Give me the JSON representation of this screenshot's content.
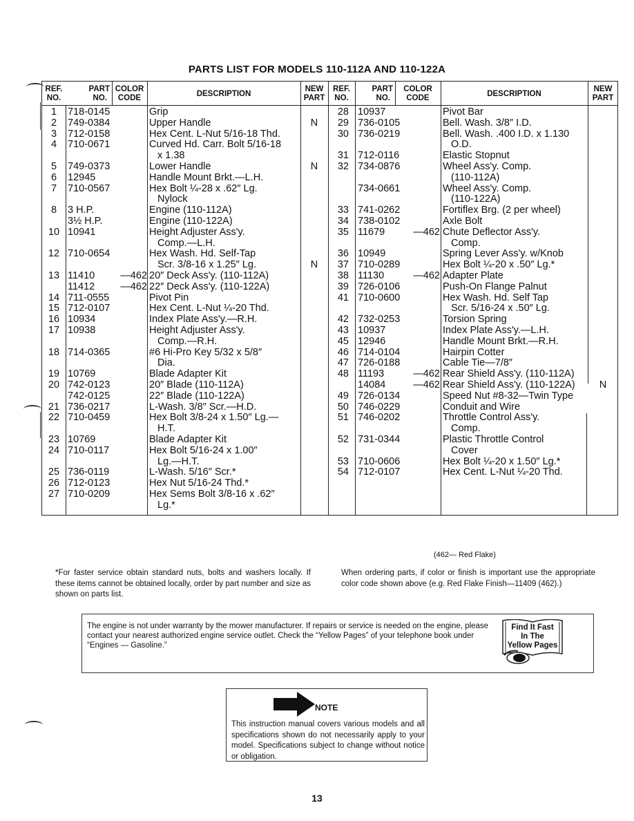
{
  "title": "PARTS LIST FOR MODELS 110-112A AND 110-122A",
  "headers": {
    "ref_no": [
      "REF.",
      "NO."
    ],
    "part_no": [
      "PART",
      "NO."
    ],
    "color_code": [
      "COLOR",
      "CODE"
    ],
    "description": "DESCRIPTION",
    "new_part": [
      "NEW",
      "PART"
    ]
  },
  "left_rows": [
    {
      "ref": "1",
      "part": "718-0145",
      "code": "",
      "desc": [
        "Grip"
      ],
      "new": ""
    },
    {
      "ref": "2",
      "part": "749-0384",
      "code": "",
      "desc": [
        "Upper Handle"
      ],
      "new": "N"
    },
    {
      "ref": "3",
      "part": "712-0158",
      "code": "",
      "desc": [
        "Hex Cent. L-Nut 5/16-18 Thd."
      ],
      "new": ""
    },
    {
      "ref": "4",
      "part": "710-0671",
      "code": "",
      "desc": [
        "Curved Hd. Carr. Bolt 5/16-18",
        "x 1.38"
      ],
      "new": ""
    },
    {
      "ref": "5",
      "part": "749-0373",
      "code": "",
      "desc": [
        "Lower Handle"
      ],
      "new": "N"
    },
    {
      "ref": "6",
      "part": "12945",
      "code": "",
      "desc": [
        "Handle Mount Brkt.—L.H."
      ],
      "new": ""
    },
    {
      "ref": "7",
      "part": "710-0567",
      "code": "",
      "desc": [
        "Hex Bolt ¼-28 x .62″ Lg.",
        "Nylock"
      ],
      "new": ""
    },
    {
      "ref": "8",
      "part": "3 H.P.",
      "code": "",
      "desc": [
        "Engine (110-112A)"
      ],
      "new": ""
    },
    {
      "ref": "",
      "part": "3½ H.P.",
      "code": "",
      "desc": [
        "Engine (110-122A)"
      ],
      "new": ""
    },
    {
      "ref": "10",
      "part": "10941",
      "code": "",
      "desc": [
        "Height Adjuster Ass'y.",
        "Comp.—L.H."
      ],
      "new": ""
    },
    {
      "ref": "12",
      "part": "710-0654",
      "code": "",
      "desc": [
        "Hex Wash. Hd. Self-Tap",
        "Scr. 3/8-16 x 1.25″ Lg."
      ],
      "new": "N"
    },
    {
      "ref": "13",
      "part": "11410",
      "code": "—462",
      "desc": [
        "20″ Deck Ass'y. (110-112A)"
      ],
      "new": ""
    },
    {
      "ref": "",
      "part": "11412",
      "code": "—462",
      "desc": [
        "22″ Deck Ass'y. (110-122A)"
      ],
      "new": ""
    },
    {
      "ref": "14",
      "part": "711-0555",
      "code": "",
      "desc": [
        "Pivot Pin"
      ],
      "new": ""
    },
    {
      "ref": "15",
      "part": "712-0107",
      "code": "",
      "desc": [
        "Hex Cent. L-Nut ¼-20 Thd."
      ],
      "new": ""
    },
    {
      "ref": "16",
      "part": "10934",
      "code": "",
      "desc": [
        "Index Plate Ass'y.—R.H."
      ],
      "new": ""
    },
    {
      "ref": "17",
      "part": "10938",
      "code": "",
      "desc": [
        "Height Adjuster Ass'y.",
        "Comp.—R.H."
      ],
      "new": ""
    },
    {
      "ref": "18",
      "part": "714-0365",
      "code": "",
      "desc": [
        "#6 Hi-Pro Key 5/32 x 5/8″",
        "Dia."
      ],
      "new": ""
    },
    {
      "ref": "19",
      "part": "10769",
      "code": "",
      "desc": [
        "Blade Adapter Kit"
      ],
      "new": ""
    },
    {
      "ref": "20",
      "part": "742-0123",
      "code": "",
      "desc": [
        "20″ Blade (110-112A)"
      ],
      "new": ""
    },
    {
      "ref": "",
      "part": "742-0125",
      "code": "",
      "desc": [
        "22″ Blade (110-122A)"
      ],
      "new": ""
    },
    {
      "ref": "21",
      "part": "736-0217",
      "code": "",
      "desc": [
        "L-Wash. 3/8″ Scr.—H.D."
      ],
      "new": ""
    },
    {
      "ref": "22",
      "part": "710-0459",
      "code": "",
      "desc": [
        "Hex Bolt 3/8-24 x 1.50″ Lg.—",
        "H.T."
      ],
      "new": ""
    },
    {
      "ref": "23",
      "part": "10769",
      "code": "",
      "desc": [
        "Blade Adapter Kit"
      ],
      "new": ""
    },
    {
      "ref": "24",
      "part": "710-0117",
      "code": "",
      "desc": [
        "Hex Bolt 5/16-24 x 1.00″",
        "Lg.—H.T."
      ],
      "new": ""
    },
    {
      "ref": "25",
      "part": "736-0119",
      "code": "",
      "desc": [
        "L-Wash. 5/16″ Scr.*"
      ],
      "new": ""
    },
    {
      "ref": "26",
      "part": "712-0123",
      "code": "",
      "desc": [
        "Hex Nut 5/16-24 Thd.*"
      ],
      "new": ""
    },
    {
      "ref": "27",
      "part": "710-0209",
      "code": "",
      "desc": [
        "Hex Sems Bolt 3/8-16 x .62″",
        "Lg.*"
      ],
      "new": ""
    }
  ],
  "right_rows": [
    {
      "ref": "28",
      "part": "10937",
      "code": "",
      "desc": [
        "Pivot Bar"
      ],
      "new": ""
    },
    {
      "ref": "29",
      "part": "736-0105",
      "code": "",
      "desc": [
        "Bell. Wash. 3/8″ I.D."
      ],
      "new": ""
    },
    {
      "ref": "30",
      "part": "736-0219",
      "code": "",
      "desc": [
        "Bell. Wash. .400 I.D. x 1.130",
        "O.D."
      ],
      "new": ""
    },
    {
      "ref": "31",
      "part": "712-0116",
      "code": "",
      "desc": [
        "Elastic Stopnut"
      ],
      "new": ""
    },
    {
      "ref": "32",
      "part": "734-0876",
      "code": "",
      "desc": [
        "Wheel Ass'y. Comp.",
        "(110-112A)"
      ],
      "new": ""
    },
    {
      "ref": "",
      "part": "734-0661",
      "code": "",
      "desc": [
        "Wheel Ass'y. Comp.",
        "(110-122A)"
      ],
      "new": ""
    },
    {
      "ref": "33",
      "part": "741-0262",
      "code": "",
      "desc": [
        "Fortiflex Brg. (2 per wheel)"
      ],
      "new": ""
    },
    {
      "ref": "34",
      "part": "738-0102",
      "code": "",
      "desc": [
        "Axle Bolt"
      ],
      "new": ""
    },
    {
      "ref": "35",
      "part": "11679",
      "code": "—462",
      "desc": [
        "Chute Deflector Ass'y.",
        "Comp."
      ],
      "new": ""
    },
    {
      "ref": "36",
      "part": "10949",
      "code": "",
      "desc": [
        "Spring Lever Ass'y. w/Knob"
      ],
      "new": ""
    },
    {
      "ref": "37",
      "part": "710-0289",
      "code": "",
      "desc": [
        "Hex Bolt ¼-20 x .50″ Lg.*"
      ],
      "new": ""
    },
    {
      "ref": "38",
      "part": "11130",
      "code": "—462",
      "desc": [
        "Adapter Plate"
      ],
      "new": ""
    },
    {
      "ref": "39",
      "part": "726-0106",
      "code": "",
      "desc": [
        "Push-On Flange Palnut"
      ],
      "new": ""
    },
    {
      "ref": "41",
      "part": "710-0600",
      "code": "",
      "desc": [
        "Hex Wash. Hd. Self Tap",
        "Scr. 5/16-24 x .50″ Lg."
      ],
      "new": ""
    },
    {
      "ref": "42",
      "part": "732-0253",
      "code": "",
      "desc": [
        "Torsion Spring"
      ],
      "new": ""
    },
    {
      "ref": "43",
      "part": "10937",
      "code": "",
      "desc": [
        "Index Plate Ass'y.—L.H."
      ],
      "new": ""
    },
    {
      "ref": "45",
      "part": "12946",
      "code": "",
      "desc": [
        "Handle Mount Brkt.—R.H."
      ],
      "new": ""
    },
    {
      "ref": "46",
      "part": "714-0104",
      "code": "",
      "desc": [
        "Hairpin Cotter"
      ],
      "new": ""
    },
    {
      "ref": "47",
      "part": "726-0188",
      "code": "",
      "desc": [
        "Cable Tie—7/8″"
      ],
      "new": ""
    },
    {
      "ref": "48",
      "part": "11193",
      "code": "—462",
      "desc": [
        "Rear Shield Ass'y. (110-112A)"
      ],
      "new": ""
    },
    {
      "ref": "",
      "part": "14084",
      "code": "—462",
      "desc": [
        "Rear Shield Ass'y. (110-122A)"
      ],
      "new": "N"
    },
    {
      "ref": "49",
      "part": "726-0134",
      "code": "",
      "desc": [
        "Speed Nut #8-32—Twin Type"
      ],
      "new": ""
    },
    {
      "ref": "50",
      "part": "746-0229",
      "code": "",
      "desc": [
        "Conduit and Wire"
      ],
      "new": ""
    },
    {
      "ref": "51",
      "part": "746-0202",
      "code": "",
      "desc": [
        "Throttle Control Ass'y.",
        "Comp."
      ],
      "new": ""
    },
    {
      "ref": "52",
      "part": "731-0344",
      "code": "",
      "desc": [
        "Plastic Throttle Control",
        "Cover"
      ],
      "new": ""
    },
    {
      "ref": "53",
      "part": "710-0606",
      "code": "",
      "desc": [
        "Hex Bolt ¼-20 x 1.50″ Lg.*"
      ],
      "new": ""
    },
    {
      "ref": "54",
      "part": "712-0107",
      "code": "",
      "desc": [
        "Hex Cent. L-Nut ¼-20 Thd."
      ],
      "new": ""
    }
  ],
  "color_legend": "(462— Red Flake)",
  "footnote_left": "*For faster service obtain standard nuts, bolts and washers locally. If these items cannot be obtained locally, order by part number and size as shown on parts list.",
  "footnote_right": "When ordering parts, if color or finish is important use the appropriate color code shown above (e.g. Red Flake Finish—11409 (462).)",
  "warranty_text": "The engine is not under warranty by the mower manufacturer. If repairs or service is needed on the engine, please contact your nearest authorized engine service outlet. Check the “Yellow Pages” of your telephone book under “Engines — Gasoline.”",
  "yellow_pages": [
    "Find It Fast",
    "In The",
    "Yellow Pages"
  ],
  "note": {
    "label": "NOTE",
    "text": "This instruction manual covers various models and all specifications shown do not necessarily apply to your model. Specifications subject to change without notice or obligation."
  },
  "page_number": "13"
}
